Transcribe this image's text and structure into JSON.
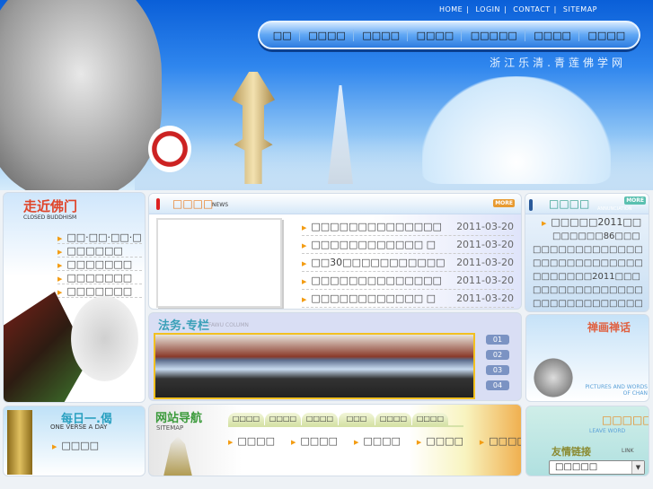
{
  "header": {
    "top_links": [
      "HOME",
      "LOGIN",
      "CONTACT",
      "SITEMAP"
    ],
    "nav": [
      "□□",
      "□□□□",
      "□□□□",
      "□□□□",
      "□□□□□",
      "□□□□",
      "□□□□"
    ],
    "slogan": "浙江乐清.青莲佛学网"
  },
  "left": {
    "title": "走近佛门",
    "subtitle": "CLOSED BUDDHISM",
    "items": [
      "□□·□□·□□·□",
      "□□□□□□",
      "□□□□□□□",
      "□□□□□□□",
      "□□□□□□□"
    ]
  },
  "verse": {
    "title": "每日一.偈",
    "subtitle": "ONE VERSE A DAY",
    "item": "□□□□"
  },
  "news": {
    "title": "□□□□",
    "en": "NEWS",
    "more": "MORE",
    "items": [
      {
        "title": "□□□□□□□□□□□□□□",
        "date": "2011-03-20"
      },
      {
        "title": "□□□□□□□□□□□□ □",
        "date": "2011-03-20"
      },
      {
        "title": "□□30□□□□□□□□□□□",
        "date": "2011-03-20"
      },
      {
        "title": "□□□□□□□□□□□□□□",
        "date": "2011-03-20"
      },
      {
        "title": "□□□□□□□□□□□□ □",
        "date": "2011-03-20"
      }
    ]
  },
  "fashu": {
    "title": "法务.专栏",
    "en": "FAWU COLUMN",
    "tabs": [
      "01",
      "02",
      "03",
      "04"
    ]
  },
  "sitemap": {
    "title": "网站导航",
    "en": "SITEMAP",
    "tabs": [
      "□□□□",
      "□□□□",
      "□□□□",
      "□□□",
      "□□□□",
      "□□□□"
    ],
    "links": [
      "□□□□",
      "□□□□",
      "□□□□",
      "□□□□",
      "□□□□"
    ]
  },
  "notice": {
    "title": "□□□□",
    "en": "ANNUNCIATION",
    "more": "MORE",
    "heading": "□□□□□2011□□",
    "body": "□□□□□□86□□□□□□□□□□□□□□□□□□□□□□□□□□□□□□□□□□□□2011□□□□□□□□□□□□□□□□□□□□□□□□□□□□□□□□"
  },
  "chan": {
    "title": "禅画禅话",
    "en": "PICTURES AND WORDS OF CHAN"
  },
  "message": {
    "title": "□□□□□",
    "en": "LEAVE WORD"
  },
  "links": {
    "title": "友情链接",
    "en": "LINK",
    "select": "□□□□□"
  }
}
